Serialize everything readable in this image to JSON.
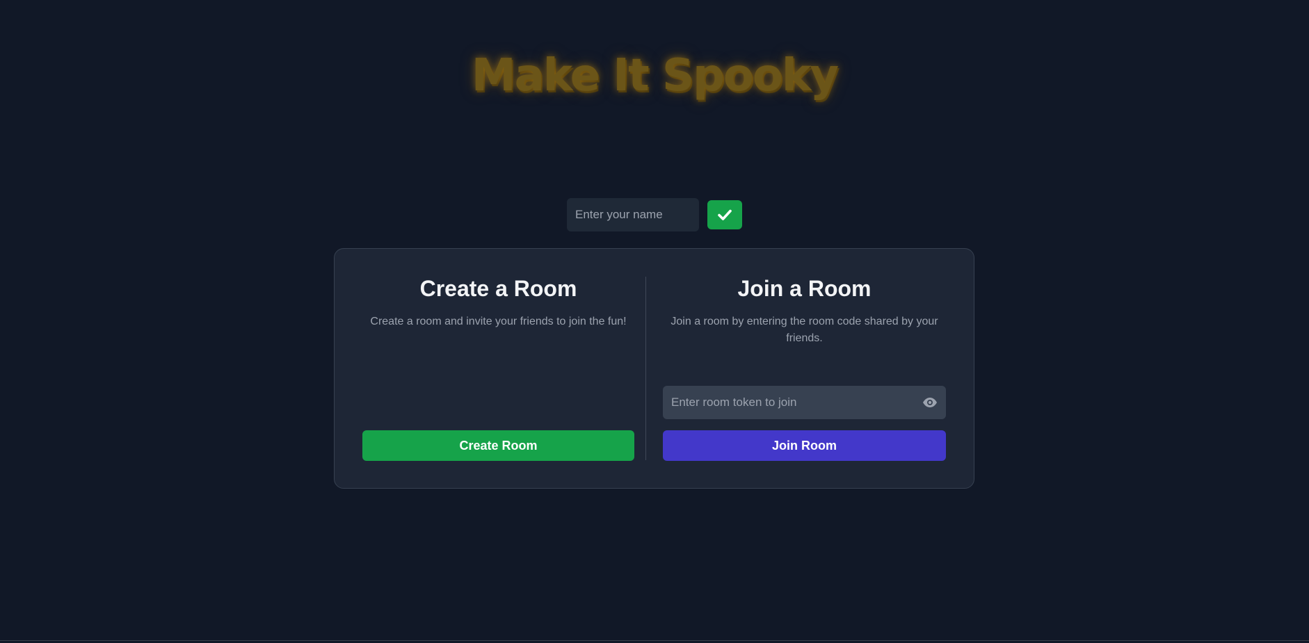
{
  "app": {
    "title": "Make It Spooky"
  },
  "name_entry": {
    "placeholder": "Enter your name",
    "value": "",
    "confirm_icon": "check-icon"
  },
  "create": {
    "title": "Create a Room",
    "description": "Create a room and invite your friends to join the fun!",
    "button_label": "Create Room"
  },
  "join": {
    "title": "Join a Room",
    "description": "Join a room by entering the room code shared by your friends.",
    "token_placeholder": "Enter room token to join",
    "token_value": "",
    "visibility_icon": "eye-icon",
    "button_label": "Join Room"
  },
  "colors": {
    "background": "#111827",
    "card": "#1e2636",
    "title_gold": "#6b5518",
    "create_green": "#16a34a",
    "join_indigo": "#4338ca"
  }
}
